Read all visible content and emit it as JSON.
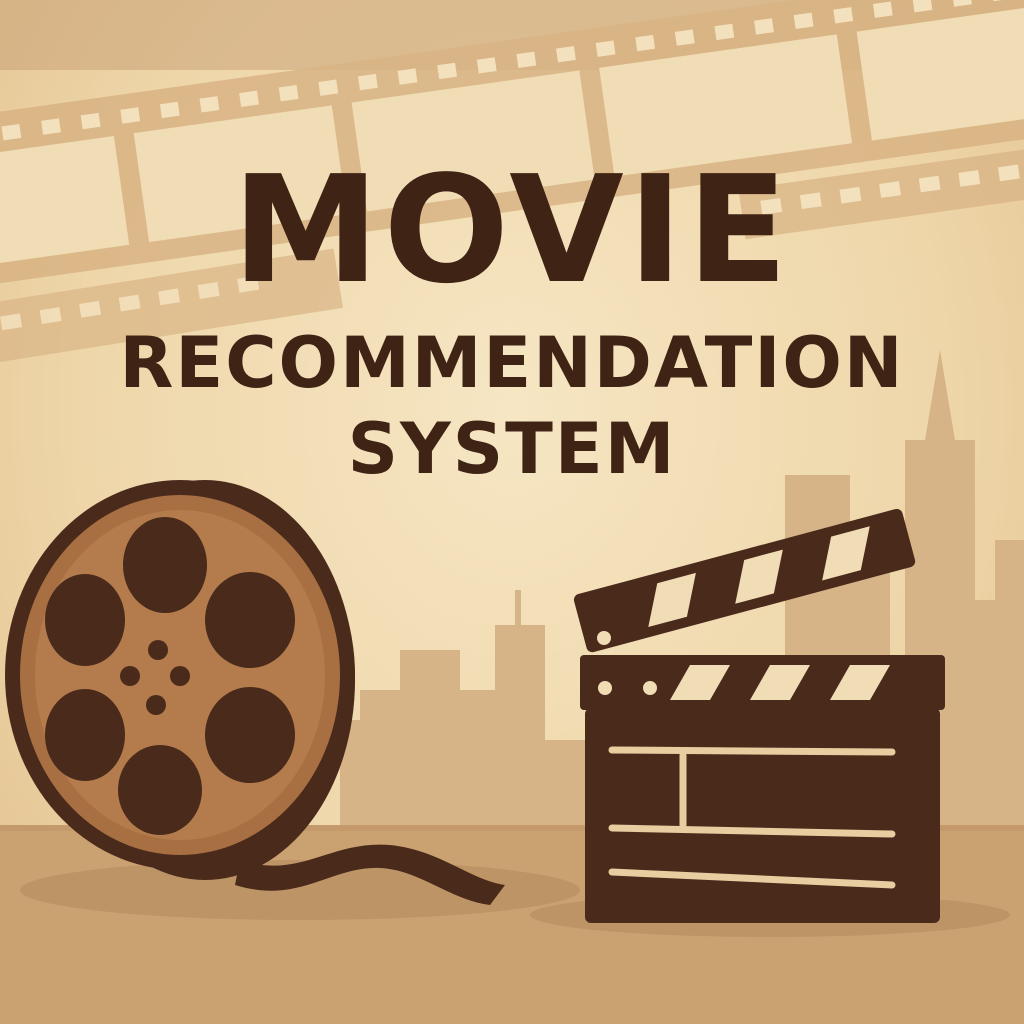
{
  "poster": {
    "title_line1": "MOVIE",
    "title_line2": "RECOMMENDATION",
    "title_line3": "SYSTEM"
  },
  "illustration": {
    "icons": [
      "film-strip-icon",
      "film-reel-icon",
      "clapperboard-icon",
      "city-skyline"
    ],
    "colors": {
      "background": "#f1dcb3",
      "text": "#3f2416",
      "dark_brown": "#4a2a1b",
      "tan": "#a86f43",
      "skyline": "#d7b487",
      "floor": "#caa272"
    }
  }
}
